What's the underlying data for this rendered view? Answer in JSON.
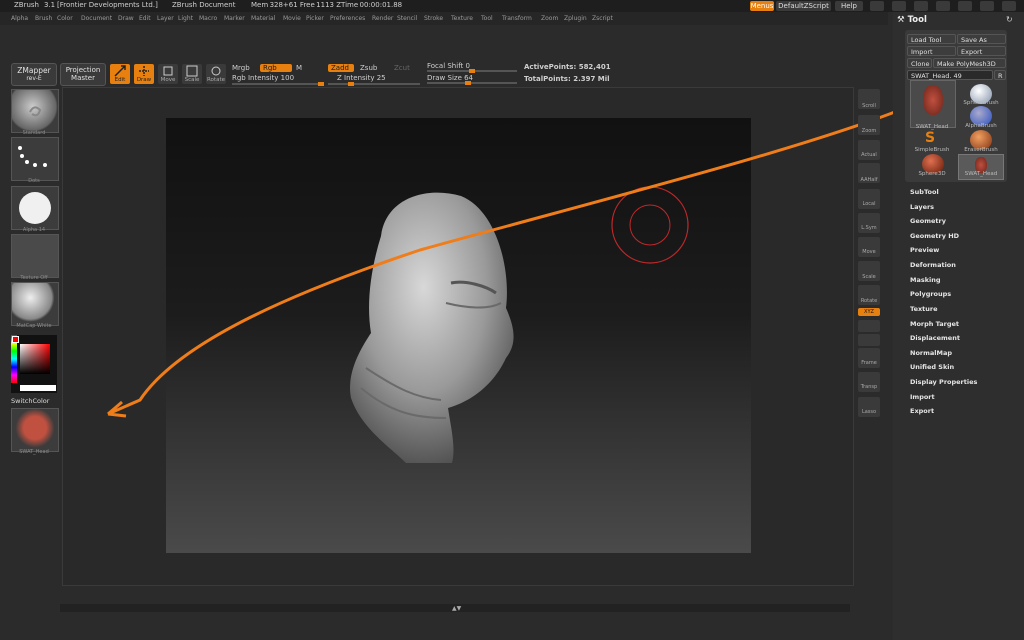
{
  "titlebar": {
    "app": "ZBrush",
    "version": "3.1",
    "company": "[Frontier Developments Ltd.]",
    "document": "ZBrush Document",
    "stats": "Mem 328+61  Free 1113  ZTime 00:00:01.88",
    "buttons": {
      "menus": "Menus",
      "script": "DefaultZScript",
      "help": "Help"
    }
  },
  "menubar": [
    "Alpha",
    "Brush",
    "Color",
    "Document",
    "Draw",
    "Edit",
    "Layer",
    "Light",
    "Macro",
    "Marker",
    "Material",
    "Movie",
    "Picker",
    "Preferences",
    "Render",
    "Stencil",
    "Stroke",
    "Texture",
    "Tool",
    "Transform",
    "Zoom",
    "Zplugin",
    "Zscript"
  ],
  "shelf": {
    "zmapper": "ZMapper",
    "zmapper_rev": "rev-E",
    "projection": "Projection",
    "projection2": "Master",
    "tools": [
      {
        "label": "Edit",
        "active": true
      },
      {
        "label": "Draw",
        "active": true
      },
      {
        "label": "Move",
        "active": false
      },
      {
        "label": "Scale",
        "active": false
      },
      {
        "label": "Rotate",
        "active": false
      }
    ],
    "mrgb": "Mrgb",
    "rgb": "Rgb",
    "m": "M",
    "rgb_intensity": "Rgb  Intensity 100",
    "zadd": "Zadd",
    "zsub": "Zsub",
    "zcut": "Zcut",
    "z_intensity": "Z  Intensity 25",
    "focal_shift": "Focal  Shift 0",
    "draw_size": "Draw  Size 64",
    "active_points": "ActivePoints: 582,401",
    "total_points": "TotalPoints: 2.397  Mil",
    "rgb_intensity_level": 1.0,
    "z_intensity_level": 0.25,
    "focal_shift_level": 0.5,
    "draw_size_level": 0.45
  },
  "left": {
    "items": [
      "Standard",
      "Dots",
      "Alpha 14",
      "Texture  Off",
      "MatCap  White"
    ],
    "switch_color": "SwitchColor",
    "tool_thumb": "SWAT_Head"
  },
  "right_shelf": [
    "Scroll",
    "Zoom",
    "Actual",
    "AAHalf",
    "Local",
    "L.Sym",
    "Move",
    "Scale",
    "Rotate",
    "XYZ",
    "",
    "",
    "Frame",
    "Transp",
    "Lasso"
  ],
  "palette": {
    "title": "Tool",
    "load": "Load Tool",
    "save": "Save As",
    "import": "Import",
    "export": "Export",
    "clone": "Clone",
    "make": "Make PolyMesh3D",
    "current": "SWAT_Head. 49",
    "r": "R",
    "brushes": [
      {
        "label": "SWAT_Head",
        "color": "#9b3a2e"
      },
      {
        "label": "SphereBrush",
        "color": "#bfc8d8"
      },
      {
        "label": "AlphaBrush",
        "color": "#3a5fd0"
      },
      {
        "label": "SimpleBrush",
        "color": "#e8800f"
      },
      {
        "label": "EraserBrush",
        "color": "#c06030"
      },
      {
        "label": "Sphere3D",
        "color": "#b04020"
      },
      {
        "label": "SWAT_Head",
        "color": "#9b3a2e"
      }
    ],
    "sections": [
      "SubTool",
      "Layers",
      "Geometry",
      "Geometry HD",
      "Preview",
      "Deformation",
      "Masking",
      "Polygroups",
      "Texture",
      "Morph Target",
      "Displacement",
      "NormalMap",
      "Unified Skin",
      "Display Properties",
      "Import",
      "Export"
    ]
  },
  "colors": {
    "accent": "#e8800f",
    "annotation": "#ef7d1a",
    "cursor": "#c0282a"
  }
}
